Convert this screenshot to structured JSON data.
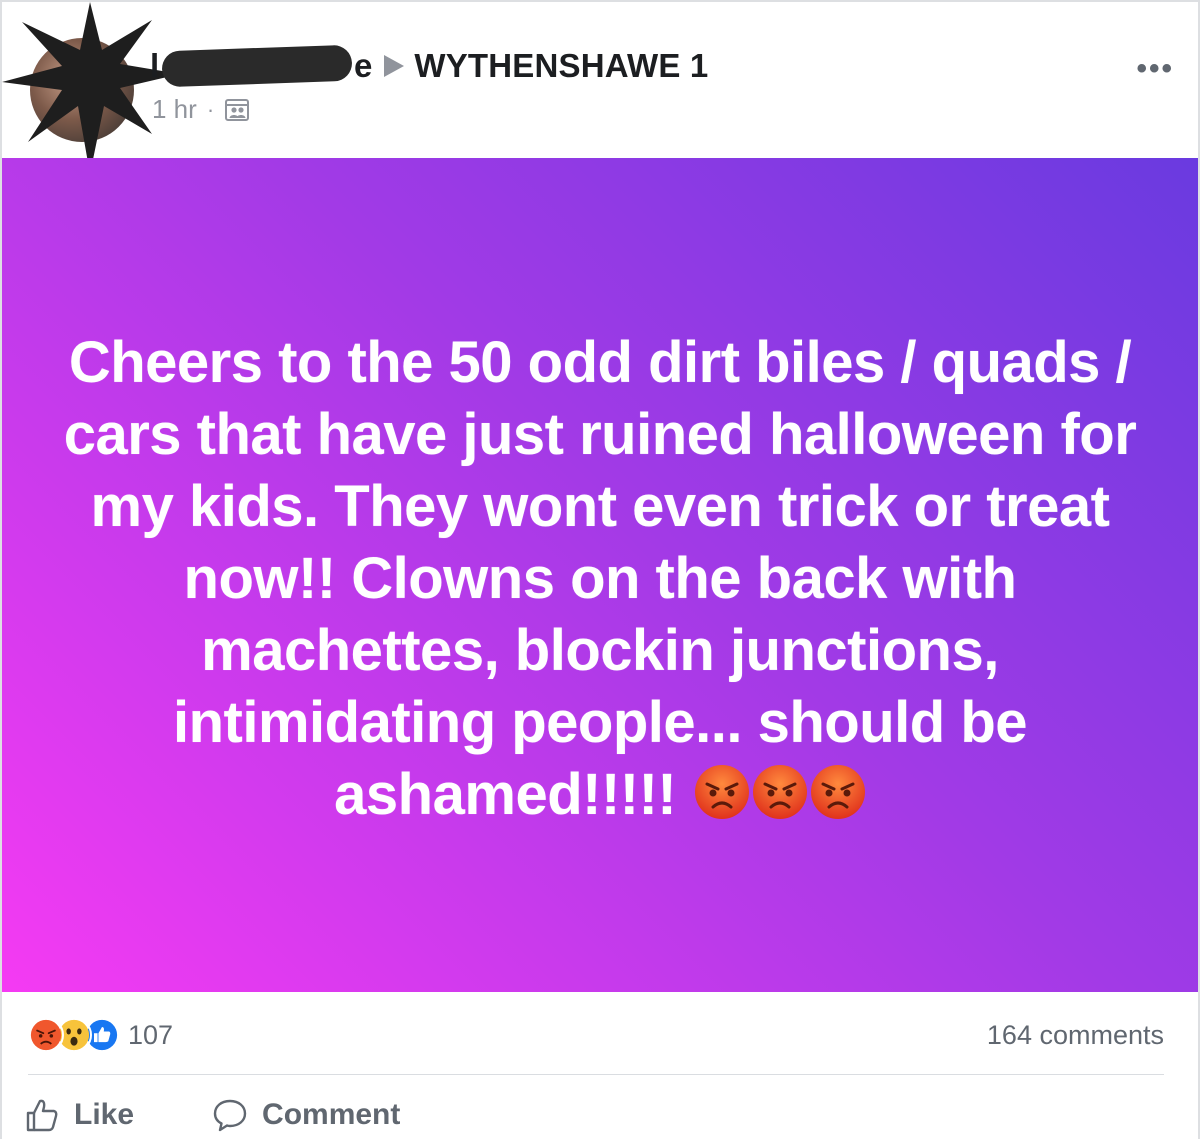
{
  "header": {
    "author_first": "l",
    "author_last": "e",
    "group_name": "WYTHENSHAWE 1",
    "time": "1 hr",
    "separator": "·",
    "audience_icon": "group-audience-icon",
    "more_label": "•••"
  },
  "post": {
    "text": "Cheers to the 50 odd dirt biles / quads / cars that have just ruined halloween for my kids. They wont even trick or treat now!! Clowns on the back with machettes, blockin junctions, intimidating people... should be ashamed!!!!!",
    "emojis": [
      "angry-face-icon",
      "angry-face-icon",
      "angry-face-icon"
    ],
    "background": [
      "#6a3ae0",
      "#a23ae6",
      "#f53af3"
    ]
  },
  "reactions": {
    "icons": [
      "angry-reaction-icon",
      "wow-reaction-icon",
      "like-reaction-icon"
    ],
    "count": "107",
    "comments": "164 comments"
  },
  "actions": {
    "like_label": "Like",
    "comment_label": "Comment"
  },
  "colors": {
    "text_primary": "#1c1e21",
    "text_secondary": "#606770",
    "like_blue": "#1877f2"
  }
}
